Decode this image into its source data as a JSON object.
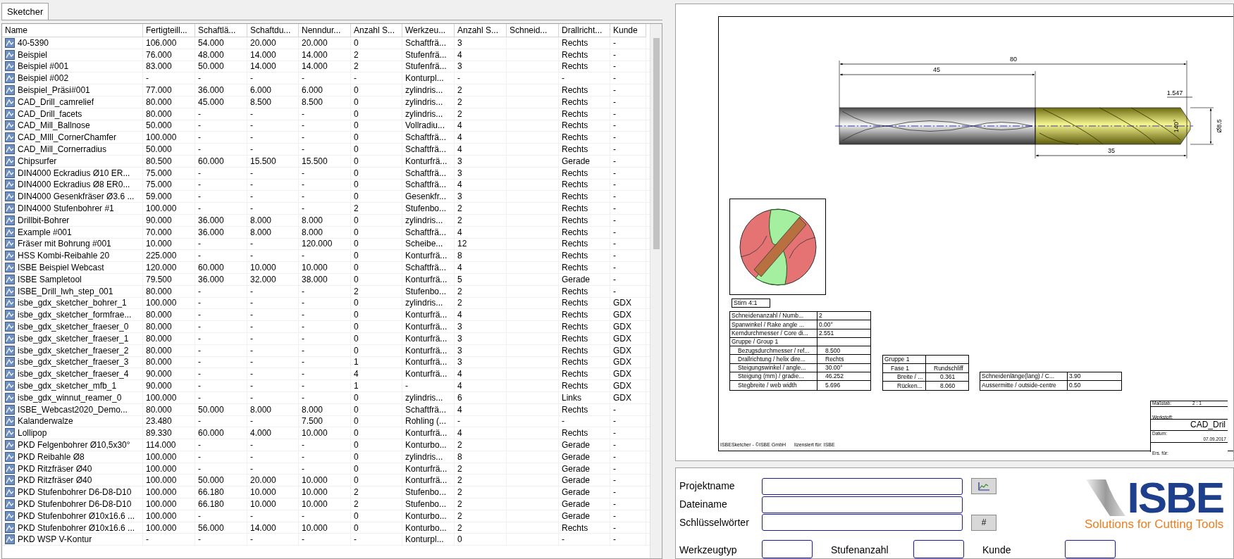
{
  "tabs": [
    {
      "label": "Sketcher",
      "selected": true
    }
  ],
  "table": {
    "columns": [
      "Name",
      "Fertigteill...",
      "Schaftlä...",
      "Schaftdu...",
      "Nenndur...",
      "Anzahl S...",
      "Werkzeu...",
      "Anzahl S...",
      "Schneid...",
      "Drallricht...",
      "Kunde"
    ],
    "rows": [
      [
        "40-5390",
        "106.000",
        "54.000",
        "20.000",
        "20.000",
        "0",
        "Schaftfrä...",
        "3",
        null,
        "Rechts",
        "-"
      ],
      [
        "Beispiel",
        "76.000",
        "48.000",
        "14.000",
        "14.000",
        "2",
        "Stufenfrä...",
        "4",
        null,
        "Rechts",
        "-"
      ],
      [
        "Beispiel #001",
        "83.000",
        "50.000",
        "14.000",
        "14.000",
        "2",
        "Stufenfrä...",
        "3",
        null,
        "Rechts",
        "-"
      ],
      [
        "Beispiel #002",
        "-",
        "-",
        "-",
        "-",
        "-",
        "Konturpl...",
        "-",
        null,
        "-",
        "-"
      ],
      [
        "Beispiel_Präsi#001",
        "77.000",
        "36.000",
        "6.000",
        "6.000",
        "0",
        "zylindris...",
        "2",
        null,
        "Rechts",
        "-"
      ],
      [
        "CAD_Drill_camrelief",
        "80.000",
        "45.000",
        "8.500",
        "8.500",
        "0",
        "zylindris...",
        "2",
        null,
        "Rechts",
        "-"
      ],
      [
        "CAD_Drill_facets",
        "80.000",
        "-",
        "-",
        "-",
        "0",
        "zylindris...",
        "2",
        null,
        "Rechts",
        "-"
      ],
      [
        "CAD_Mill_Ballnose",
        "50.000",
        "-",
        "-",
        "-",
        "0",
        "Vollradiu...",
        "4",
        null,
        "Rechts",
        "-"
      ],
      [
        "CAD_MIll_CornerChamfer",
        "100.000",
        "-",
        "-",
        "-",
        "0",
        "Schaftfrä...",
        "4",
        null,
        "Rechts",
        "-"
      ],
      [
        "CAD_Mill_Cornerradius",
        "50.000",
        "-",
        "-",
        "-",
        "0",
        "Schaftfrä...",
        "4",
        null,
        "Rechts",
        "-"
      ],
      [
        "Chipsurfer",
        "80.500",
        "60.000",
        "15.500",
        "15.500",
        "0",
        "Konturfrä...",
        "3",
        null,
        "Gerade",
        "-"
      ],
      [
        "DIN4000 Eckradius Ø10 ER...",
        "75.000",
        "-",
        "-",
        "-",
        "0",
        "Schaftfrä...",
        "3",
        null,
        "Rechts",
        "-"
      ],
      [
        "DIN4000 Eckradius Ø8 ER0...",
        "75.000",
        "-",
        "-",
        "-",
        "0",
        "Schaftfrä...",
        "4",
        null,
        "Rechts",
        "-"
      ],
      [
        "DIN4000 Gesenkfräser Ø3.6 ...",
        "59.000",
        "-",
        "-",
        "-",
        "0",
        "Gesenkfr...",
        "3",
        null,
        "Rechts",
        "-"
      ],
      [
        "DIN4000 Stufenbohrer #1",
        "100.000",
        "-",
        "-",
        "-",
        "2",
        "Stufenbo...",
        "2",
        null,
        "Rechts",
        "-"
      ],
      [
        "Drillbit-Bohrer",
        "90.000",
        "36.000",
        "8.000",
        "8.000",
        "0",
        "zylindris...",
        "2",
        null,
        "Rechts",
        "-"
      ],
      [
        "Example #001",
        "70.000",
        "36.000",
        "8.000",
        "8.000",
        "0",
        "Schaftfrä...",
        "4",
        null,
        "Rechts",
        "-"
      ],
      [
        "Fräser mit Bohrung #001",
        "10.000",
        "-",
        "-",
        "120.000",
        "0",
        "Scheibe...",
        "12",
        null,
        "Rechts",
        "-"
      ],
      [
        "HSS Kombi-Reibahle 20",
        "225.000",
        "-",
        "-",
        "-",
        "0",
        "Konturfrä...",
        "8",
        null,
        "Rechts",
        "-"
      ],
      [
        "ISBE Beispiel Webcast",
        "120.000",
        "60.000",
        "10.000",
        "10.000",
        "0",
        "Schaftfrä...",
        "4",
        null,
        "Rechts",
        "-"
      ],
      [
        "ISBE Sampletool",
        "79.500",
        "36.000",
        "32.000",
        "38.000",
        "0",
        "Konturfrä...",
        "5",
        null,
        "Gerade",
        "-"
      ],
      [
        "ISBE_Drill_lwh_step_001",
        "80.000",
        "-",
        "-",
        "-",
        "2",
        "Stufenbo...",
        "2",
        null,
        "Rechts",
        "-"
      ],
      [
        "isbe_gdx_sketcher_bohrer_1",
        "100.000",
        "-",
        "-",
        "-",
        "0",
        "zylindris...",
        "2",
        null,
        "Rechts",
        "GDX"
      ],
      [
        "isbe_gdx_sketcher_formfrae...",
        "80.000",
        "-",
        "-",
        "-",
        "0",
        "Konturfrä...",
        "4",
        null,
        "Rechts",
        "GDX"
      ],
      [
        "isbe_gdx_sketcher_fraeser_0",
        "80.000",
        "-",
        "-",
        "-",
        "0",
        "Konturfrä...",
        "3",
        null,
        "Rechts",
        "GDX"
      ],
      [
        "isbe_gdx_sketcher_fraeser_1",
        "80.000",
        "-",
        "-",
        "-",
        "0",
        "Konturfrä...",
        "3",
        null,
        "Rechts",
        "GDX"
      ],
      [
        "isbe_gdx_sketcher_fraeser_2",
        "80.000",
        "-",
        "-",
        "-",
        "0",
        "Konturfrä...",
        "3",
        null,
        "Rechts",
        "GDX"
      ],
      [
        "isbe_gdx_sketcher_fraeser_3",
        "80.000",
        "-",
        "-",
        "-",
        "1",
        "Konturfrä...",
        "3",
        null,
        "Rechts",
        "GDX"
      ],
      [
        "isbe_gdx_sketcher_fraeser_4",
        "90.000",
        "-",
        "-",
        "-",
        "4",
        "Konturfrä...",
        "4",
        null,
        "Rechts",
        "GDX"
      ],
      [
        "isbe_gdx_sketcher_mfb_1",
        "90.000",
        "-",
        "-",
        "-",
        "1",
        "-",
        "4",
        null,
        "Rechts",
        "GDX"
      ],
      [
        "isbe_gdx_winnut_reamer_0",
        "100.000",
        "-",
        "-",
        "-",
        "0",
        "zylindris...",
        "6",
        null,
        "Links",
        "GDX"
      ],
      [
        "ISBE_Webcast2020_Demo...",
        "80.000",
        "50.000",
        "8.000",
        "8.000",
        "0",
        "Schaftfrä...",
        "4",
        null,
        "Rechts",
        "-"
      ],
      [
        "Kalanderwalze",
        "23.480",
        "-",
        "-",
        "7.500",
        "0",
        "Rohling (...",
        "-",
        null,
        "-",
        "-"
      ],
      [
        "Lollipop",
        "89.330",
        "60.000",
        "4.000",
        "10.000",
        "0",
        "Konturfrä...",
        "4",
        null,
        "Rechts",
        "-"
      ],
      [
        "PKD Felgenbohrer Ø10,5x30°",
        "114.000",
        "-",
        "-",
        "-",
        "0",
        "Konturbo...",
        "2",
        null,
        "Gerade",
        "-"
      ],
      [
        "PKD Reibahle Ø8",
        "100.000",
        "-",
        "-",
        "-",
        "0",
        "zylindris...",
        "8",
        null,
        "Gerade",
        "-"
      ],
      [
        "PKD Ritzfräser Ø40",
        "100.000",
        "-",
        "-",
        "-",
        "0",
        "Konturfrä...",
        "2",
        null,
        "Gerade",
        "-"
      ],
      [
        "PKD Ritzfräser Ø40",
        "100.000",
        "50.000",
        "20.000",
        "10.000",
        "0",
        "Konturfrä...",
        "2",
        null,
        "Gerade",
        "-"
      ],
      [
        "PKD Stufenbohrer D6-D8-D10",
        "100.000",
        "66.180",
        "10.000",
        "10.000",
        "2",
        "Stufenbo...",
        "2",
        null,
        "Gerade",
        "-"
      ],
      [
        "PKD Stufenbohrer D6-D8-D10",
        "100.000",
        "66.180",
        "10.000",
        "10.000",
        "2",
        "Stufenbo...",
        "2",
        null,
        "Gerade",
        "-"
      ],
      [
        "PKD Stufenbohrer Ø10x16.6 ...",
        "100.000",
        "-",
        "-",
        "-",
        "0",
        "Konturbo...",
        "2",
        null,
        "Gerade",
        "-"
      ],
      [
        "PKD Stufenbohrer Ø10x16.6 ...",
        "100.000",
        "56.000",
        "14.000",
        "10.000",
        "0",
        "Konturbo...",
        "2",
        null,
        "Rechts",
        "-"
      ],
      [
        "PKD WSP V-Kontur",
        "-",
        "-",
        "-",
        "-",
        "-",
        "Konturpl...",
        "0",
        null,
        "-",
        "-"
      ]
    ]
  },
  "drawing": {
    "dimensions": {
      "overall": "80",
      "shank": "45",
      "tip": "1.547",
      "angle": "140°",
      "diameter": "Ø8.5",
      "flute": "35"
    },
    "view_label": "Stirn 4:1",
    "table_1": [
      {
        "label": "Schneidenanzahl / Numb...",
        "value": "2"
      },
      {
        "label": "Spanwinkel / Rake angle ...",
        "value": "0.00°"
      },
      {
        "label": "Kerndurchmesser / Core di...",
        "value": "2.551"
      },
      {
        "label": "Gruppe / Group 1",
        "children": [
          {
            "label": "Bezugsdurchmesser / ref...",
            "value": "8.500"
          },
          {
            "label": "Drallrichtung / helix dire...",
            "value": "Rechts"
          },
          {
            "label": "Steigungswinkel / angle...",
            "value": "30.00°"
          },
          {
            "label": "Steigung (mm) / gradie...",
            "value": "46.252"
          },
          {
            "label": "Stegbreite / web width",
            "value": "5.696"
          }
        ]
      }
    ],
    "table_2": [
      {
        "label": "Gruppe 1",
        "children": [
          {
            "label": "Fase 1",
            "value": "Rundschliff",
            "children": [
              {
                "label": "Breite / ...",
                "value": "0.361"
              },
              {
                "label": "Rücken...",
                "value": "8.060"
              }
            ]
          }
        ]
      }
    ],
    "table_3": [
      {
        "label": "Schneidenlänge(lang) / C...",
        "value": "3.90"
      },
      {
        "label": "Aussermitte / outside-centre",
        "value": "0.50"
      }
    ],
    "title_block": {
      "scale_label": "Maßstab:",
      "scale": "2 : 1",
      "material_label": "Werkstoff:",
      "name": "CAD_Dril",
      "date_label": "Datum:",
      "date": "07.09.2017",
      "replaces_label": "Ers. für:"
    },
    "footer": [
      "ISBESketcher - ©ISBE GmbH",
      "lizensiert für: ISBE"
    ]
  },
  "form": {
    "fields": [
      {
        "label": "Projektname",
        "action": {
          "kind": "icon"
        }
      },
      {
        "label": "Dateiname"
      },
      {
        "label": "Schlüsselwörter",
        "action": {
          "kind": "text",
          "label": "#"
        }
      }
    ],
    "short_fields": [
      {
        "label": "Werkzeugtyp"
      },
      {
        "label": "Stufenanzahl"
      },
      {
        "label": "Kunde"
      }
    ],
    "logo": {
      "wordmark": "ISBE",
      "slogan": "Solutions for Cutting Tools"
    }
  }
}
